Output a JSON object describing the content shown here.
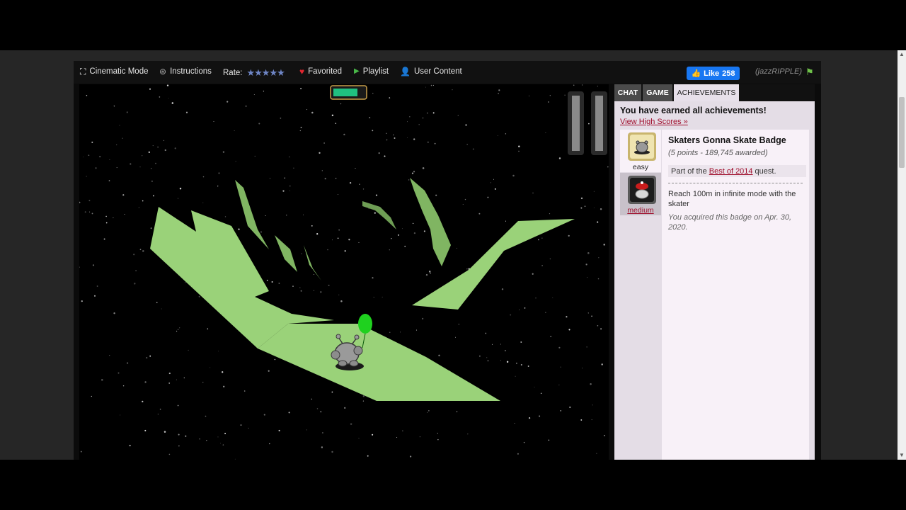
{
  "toolbar": {
    "cinematic_label": "Cinematic Mode",
    "instructions_label": "Instructions",
    "rate_label": "Rate:",
    "rating_stars": "★★★★★",
    "favorited_label": "Favorited",
    "playlist_label": "Playlist",
    "user_content_label": "User Content",
    "like_label": "Like",
    "like_count": "258",
    "username": "(jazzRIPPLE)"
  },
  "game": {
    "energy_level": 0.8,
    "colors": {
      "track": "#9ad279",
      "energy": "#20c080",
      "balloon": "#1fd11f"
    }
  },
  "sidebar": {
    "tabs": [
      "CHAT",
      "GAME",
      "ACHIEVEMENTS"
    ],
    "earned_title": "You have earned all achievements!",
    "view_high_scores": "View High Scores »",
    "badges": [
      {
        "label": "easy"
      },
      {
        "label": "medium"
      }
    ],
    "badge": {
      "title": "Skaters Gonna Skate Badge",
      "points": "(5 points - 189,745 awarded)",
      "quest_prefix": "Part of the",
      "quest_link": "Best of 2014",
      "quest_suffix": "quest.",
      "description": "Reach 100m in infinite mode with the skater",
      "acquired": "You acquired this badge on Apr. 30, 2020."
    }
  }
}
